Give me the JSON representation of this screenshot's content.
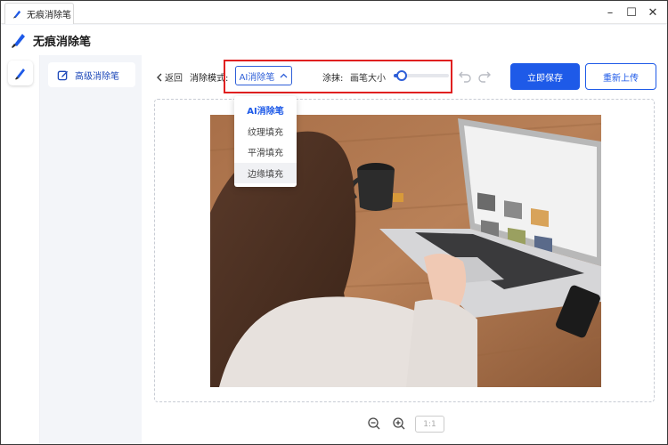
{
  "window": {
    "tab_title": "无痕消除笔",
    "controls": {
      "minimize": "–",
      "maximize": "☐",
      "close": "✕"
    }
  },
  "app": {
    "title": "无痕消除笔"
  },
  "sidebar": {
    "items": [
      {
        "label": "高级消除笔",
        "icon": "edit-square-icon"
      }
    ]
  },
  "toolbar": {
    "back_label": "返回",
    "mode_label": "消除模式:",
    "mode_value": "AI消除笔",
    "brush_label": "涂抹:",
    "brush_size_label": "画笔大小",
    "brush_size_fraction": 0.15,
    "save_label": "立即保存",
    "reupload_label": "重新上传"
  },
  "dropdown": {
    "options": [
      "AI消除笔",
      "纹理填充",
      "平滑填充",
      "边缘填充"
    ],
    "selected_index": 0,
    "hover_index": 3
  },
  "zoom": {
    "fit_label": "1:1"
  },
  "colors": {
    "accent": "#1e5ae8",
    "highlight_border": "#e02020"
  }
}
